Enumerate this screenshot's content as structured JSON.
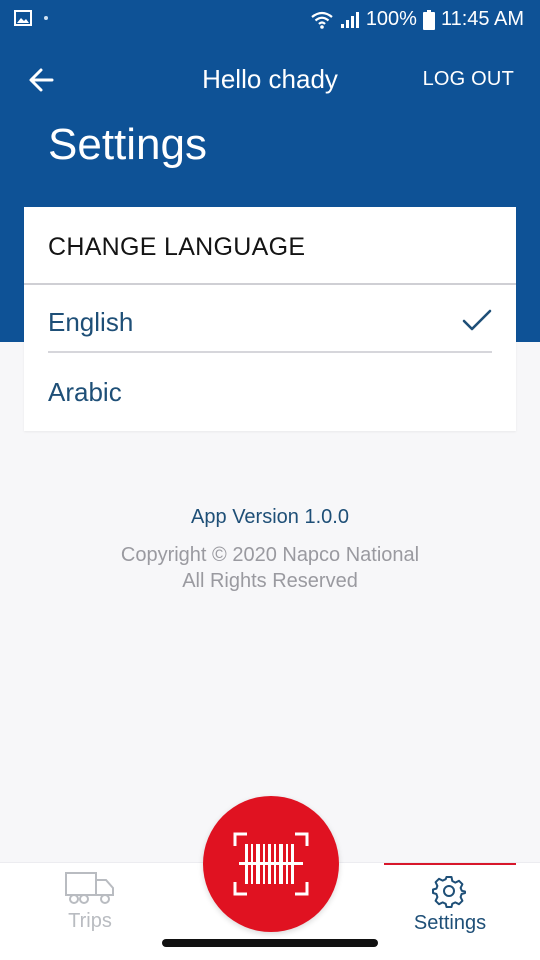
{
  "status_bar": {
    "battery": "100%",
    "time": "11:45 AM"
  },
  "header": {
    "greeting": "Hello chady",
    "logout_label": "LOG OUT",
    "title": "Settings"
  },
  "language_card": {
    "title": "CHANGE LANGUAGE",
    "options": [
      {
        "label": "English",
        "selected": true
      },
      {
        "label": "Arabic",
        "selected": false
      }
    ]
  },
  "footer": {
    "version": "App Version 1.0.0",
    "copyright_line1": "Copyright © 2020 Napco National",
    "copyright_line2": "All Rights Reserved"
  },
  "bottom_nav": {
    "items": [
      {
        "label": "Trips",
        "icon": "truck-icon",
        "active": false
      },
      {
        "label": "Settings",
        "icon": "gear-icon",
        "active": true
      }
    ],
    "scan_icon": "barcode-scan-icon"
  },
  "colors": {
    "brand_blue": "#0e5296",
    "text_blue": "#1e4f77",
    "accent_red": "#e01221"
  }
}
